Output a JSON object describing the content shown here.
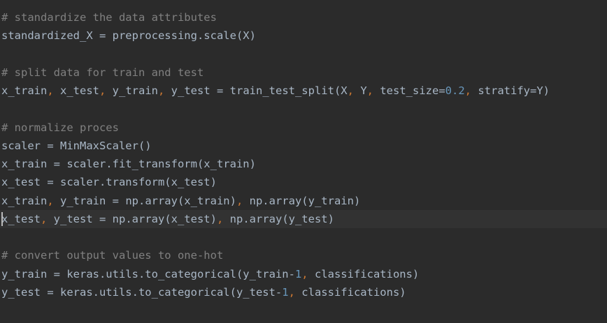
{
  "editor": {
    "comments": {
      "c1": "# standardize the data attributes",
      "c2": "# split data for train and test",
      "c3": "# normalize proces",
      "c4": "# convert output values to one-hot"
    },
    "code": {
      "l2": "standardized_X = preprocessing.scale(X)",
      "l5a": "x_train",
      "l5b": " x_test",
      "l5c": " y_train",
      "l5d": " y_test = train_test_split(X",
      "l5e": " Y",
      "l5f": " test_size=",
      "l5g": "0.2",
      "l5h": " stratify=Y)",
      "l8": "scaler = MinMaxScaler()",
      "l9": "x_train = scaler.fit_transform(x_train)",
      "l10": "x_test = scaler.transform(x_test)",
      "l11a": "x_train",
      "l11b": " y_train = np.array(x_train)",
      "l11c": " np.array(y_train)",
      "l12a": "x_test",
      "l12b": " y_test = np.array(x_test)",
      "l12c": " np.array(y_test)",
      "l15a": "y_train = keras.utils.to_categorical(y_train-",
      "l15b": "1",
      "l15c": " classifications)",
      "l16a": "y_test = keras.utils.to_categorical(y_test-",
      "l16b": "1",
      "l16c": " classifications)"
    },
    "separator": ",",
    "colors": {
      "background": "#2b2b2b",
      "current_line": "#323232",
      "text": "#a9b7c6",
      "comment": "#808080",
      "number": "#6897bb",
      "punctuation": "#cc7832"
    }
  }
}
